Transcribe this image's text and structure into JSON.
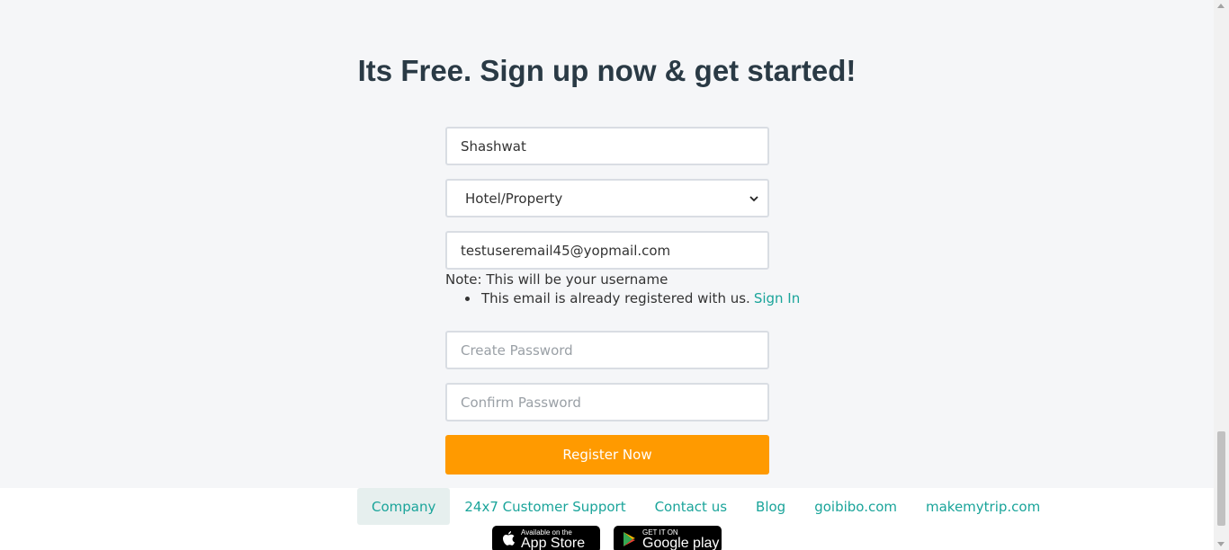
{
  "signup": {
    "title": "Its Free. Sign up now & get started!",
    "name_value": "Shashwat",
    "type_selected": "Hotel/Property",
    "email_value": "testuseremail45@yopmail.com",
    "note": "Note: This will be your username",
    "error_text": "This email is already registered with us.",
    "sign_in_link": "Sign In",
    "password_placeholder": "Create Password",
    "confirm_placeholder": "Confirm Password",
    "register_label": "Register Now"
  },
  "footer": {
    "links": [
      "Company",
      "24x7 Customer Support",
      "Contact us",
      "Blog",
      "goibibo.com",
      "makemytrip.com"
    ],
    "app_store_small": "Available on the",
    "app_store_big": "App Store",
    "play_small": "GET IT ON",
    "play_big": "Google play"
  },
  "colors": {
    "accent": "#1aa49a",
    "button": "#ff9a00"
  }
}
